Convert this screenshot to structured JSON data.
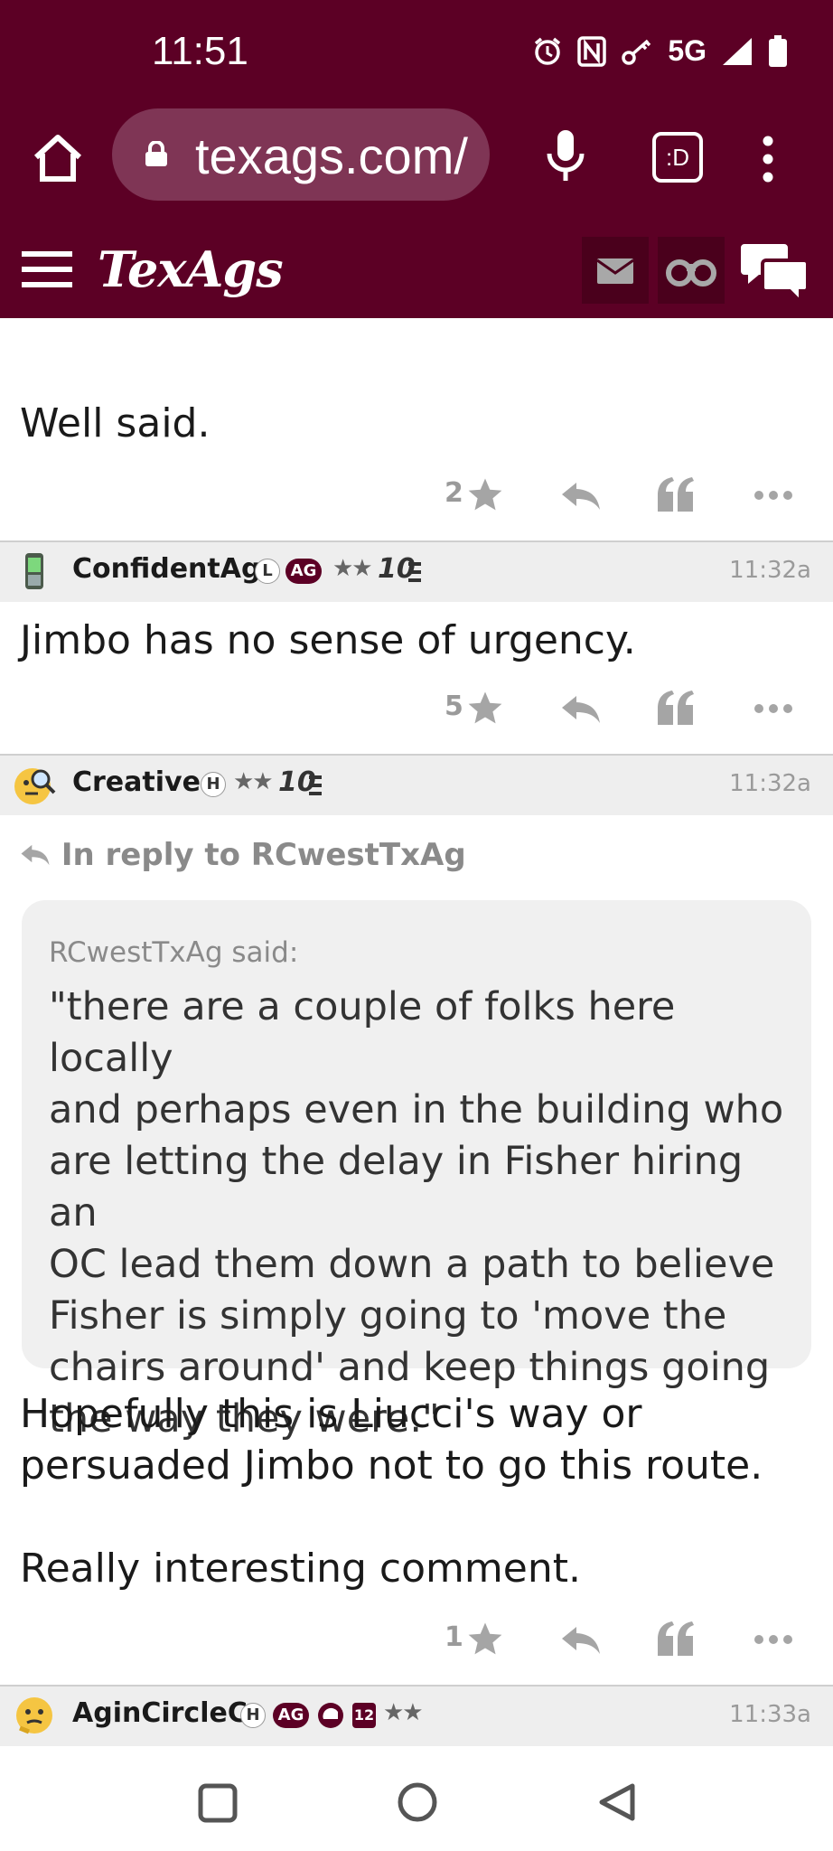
{
  "status_bar": {
    "time": "11:51",
    "network": "5G"
  },
  "browser": {
    "url": "texags.com/",
    "tab_label": ":D"
  },
  "site": {
    "logo": "TexAgs"
  },
  "posts": [
    {
      "body": "Well said.",
      "star_count": "2"
    },
    {
      "user": "ConfidentAg",
      "badges": [
        "L",
        "AG"
      ],
      "stars": "★★",
      "tenure": "10",
      "time": "11:32a",
      "body": "Jimbo has no sense of urgency.",
      "star_count": "5"
    },
    {
      "user": "Creative",
      "badges": [
        "H"
      ],
      "stars": "★★",
      "tenure": "10",
      "time": "11:32a",
      "in_reply_to": "In reply to RCwestTxAg",
      "quote_author": "RCwestTxAg said:",
      "quote_lines": [
        "\"there are a couple of folks here locally",
        "and perhaps even in the building who",
        "are letting the delay in Fisher hiring an",
        "OC lead them down a path to believe",
        "Fisher is simply going to 'move the",
        "chairs around' and keep things going",
        "the way they were.\""
      ],
      "body_lines": [
        "Hopefully this is Liucci's way or",
        "persuaded Jimbo not to go this route.",
        "",
        "Really interesting comment."
      ],
      "star_count": "1"
    },
    {
      "user": "AginCircleC",
      "badges": [
        "H",
        "AG",
        "12"
      ],
      "stars": "★★",
      "time": "11:33a"
    }
  ],
  "colors": {
    "maroon": "#5c0025",
    "gray_text": "#9a9a9a"
  }
}
